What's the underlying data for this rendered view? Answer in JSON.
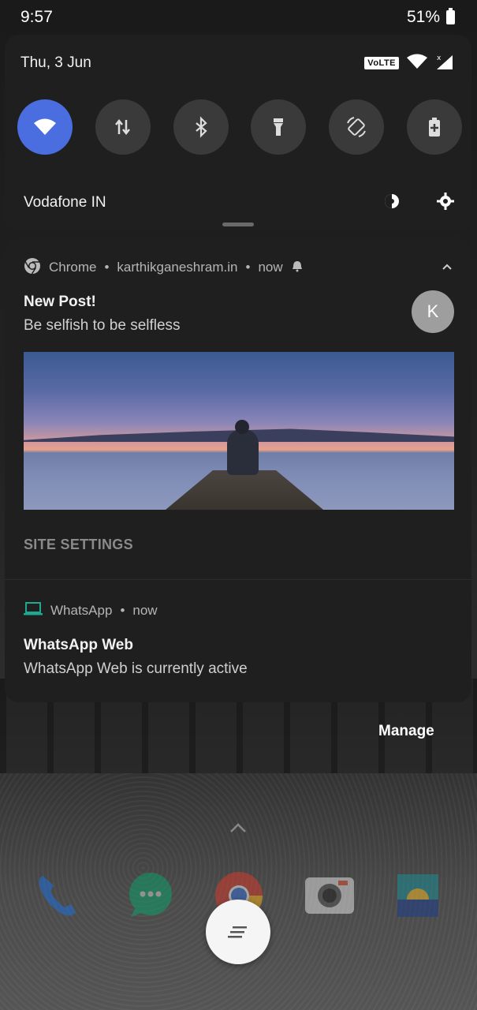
{
  "status_bar": {
    "time": "9:57",
    "battery": "51%"
  },
  "quick_settings": {
    "date": "Thu, 3 Jun",
    "volte": "VoLTE",
    "carrier": "Vodafone IN",
    "tiles": [
      {
        "name": "wifi",
        "active": true
      },
      {
        "name": "mobile-data",
        "active": false
      },
      {
        "name": "bluetooth",
        "active": false
      },
      {
        "name": "flashlight",
        "active": false
      },
      {
        "name": "auto-rotate",
        "active": false
      },
      {
        "name": "battery-saver",
        "active": false
      }
    ]
  },
  "notifications": {
    "chrome": {
      "app": "Chrome",
      "site": "karthikganeshram.in",
      "time": "now",
      "separator": "•",
      "title": "New Post!",
      "text": "Be selfish to be selfless",
      "avatar_letter": "K",
      "action": "SITE SETTINGS"
    },
    "whatsapp": {
      "app": "WhatsApp",
      "time": "now",
      "separator": "•",
      "title": "WhatsApp Web",
      "text": "WhatsApp Web is currently active"
    }
  },
  "manage_label": "Manage",
  "colors": {
    "accent": "#4a6ee0",
    "panel": "#1f1f1f",
    "whatsapp_icon": "#1fa890"
  }
}
